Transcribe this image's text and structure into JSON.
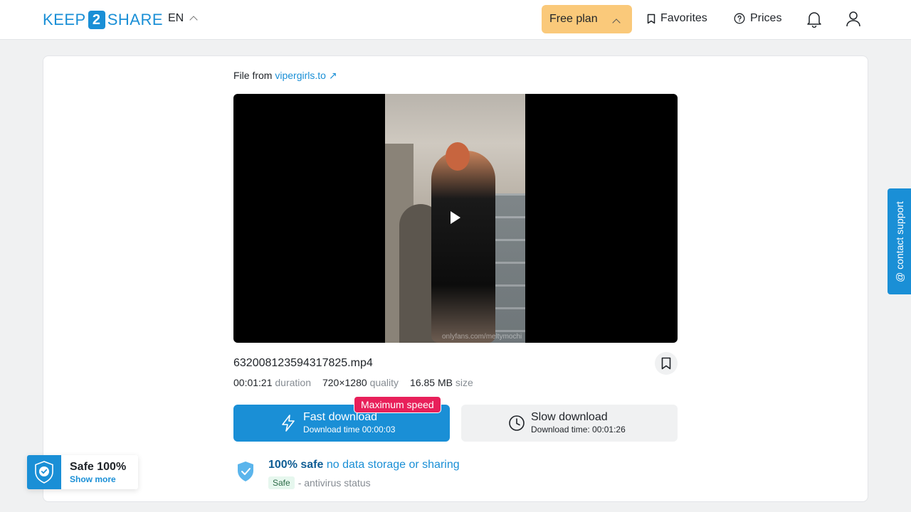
{
  "header": {
    "logo_left": "KEEP",
    "logo_num": "2",
    "logo_right": "SHARE",
    "language": "EN",
    "plan_label": "Free plan",
    "favorites_label": "Favorites",
    "prices_label": "Prices"
  },
  "file": {
    "source_prefix": "File from",
    "source_link": "vipergirls.to ↗",
    "name": "632008123594317825.mp4",
    "duration_value": "00:01:21",
    "duration_label": "duration",
    "quality_value": "720×1280",
    "quality_label": "quality",
    "size_value": "16.85 MB",
    "size_label": "size",
    "video_watermark": "onlyfans.com/meltymochi"
  },
  "download": {
    "max_speed_badge": "Maximum speed",
    "fast_label": "Fast download",
    "fast_time": "Download time 00:00:03",
    "slow_label": "Slow download",
    "slow_time": "Download time: 00:01:26"
  },
  "safety": {
    "title_bold": "100% safe",
    "title_rest": " no data storage or sharing",
    "status_pill": "Safe",
    "status_text": "- antivirus status"
  },
  "float_badge": {
    "title": "Safe 100%",
    "link": "Show more"
  },
  "contact": {
    "label": "@ contact support"
  },
  "colors": {
    "brand": "#1a8fd6",
    "plan": "#fac97a",
    "badge": "#e8205a"
  }
}
